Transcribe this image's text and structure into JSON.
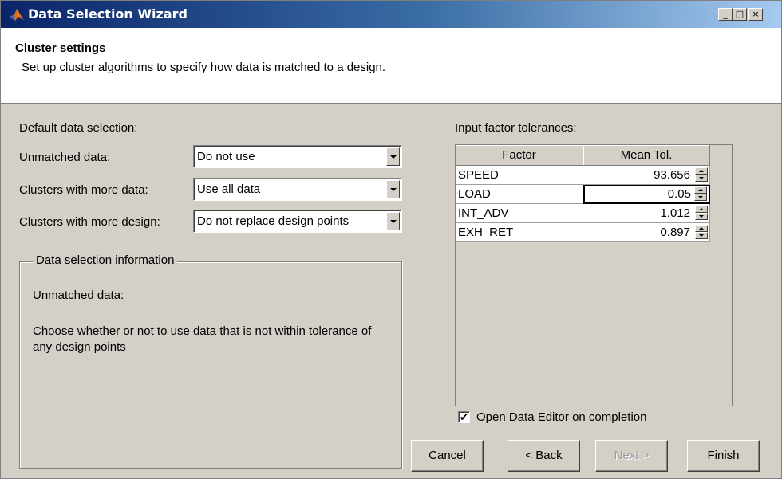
{
  "window": {
    "title": "Data Selection Wizard"
  },
  "header": {
    "title": "Cluster settings",
    "subtitle": "Set up cluster algorithms to specify how data is matched to a design."
  },
  "left": {
    "section_label": "Default data selection:",
    "rows": [
      {
        "label": "Unmatched data:",
        "value": "Do not use"
      },
      {
        "label": "Clusters with more data:",
        "value": "Use all data"
      },
      {
        "label": "Clusters with more design:",
        "value": "Do not replace design points"
      }
    ],
    "info_group": {
      "legend": "Data selection information",
      "heading": "Unmatched data:",
      "body": "Choose whether or not to use data that is not within tolerance of any design points"
    }
  },
  "right": {
    "section_label": "Input factor tolerances:",
    "columns": [
      "Factor",
      "Mean Tol."
    ],
    "rows": [
      {
        "factor": "SPEED",
        "value": "93.656"
      },
      {
        "factor": "LOAD",
        "value": "0.05"
      },
      {
        "factor": "INT_ADV",
        "value": "1.012"
      },
      {
        "factor": "EXH_RET",
        "value": "0.897"
      }
    ],
    "checkbox": {
      "label": "Open Data Editor on completion",
      "checked": true
    }
  },
  "buttons": {
    "cancel": "Cancel",
    "back": "< Back",
    "next": "Next >",
    "finish": "Finish"
  },
  "title_buttons": {
    "minimize": "_",
    "maximize": "□",
    "close": "×"
  }
}
